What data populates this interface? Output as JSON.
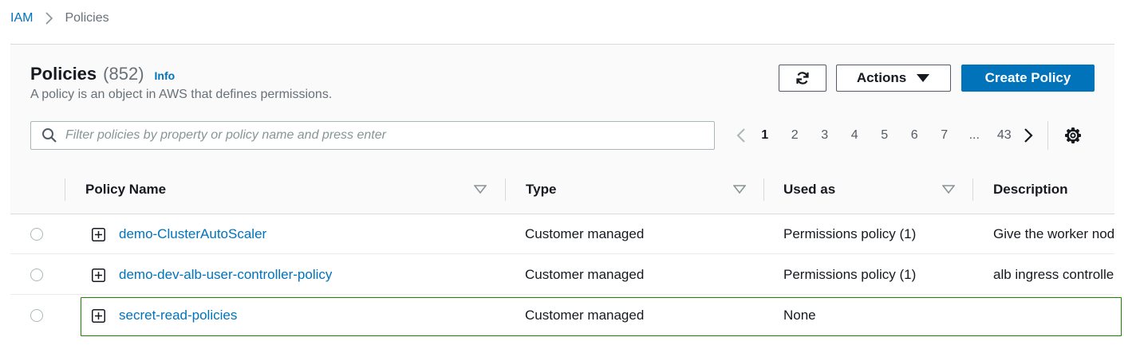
{
  "breadcrumb": {
    "root": "IAM",
    "current": "Policies"
  },
  "header": {
    "title": "Policies",
    "count": "(852)",
    "info": "Info",
    "description": "A policy is an object in AWS that defines permissions."
  },
  "toolbar": {
    "refresh_icon": "refresh-icon",
    "actions_label": "Actions",
    "create_label": "Create Policy"
  },
  "search": {
    "value": "",
    "placeholder": "Filter policies by property or policy name and press enter"
  },
  "pagination": {
    "pages": [
      "1",
      "2",
      "3",
      "4",
      "5",
      "6",
      "7"
    ],
    "current": "1",
    "ellipsis": "...",
    "last": "43"
  },
  "table": {
    "columns": [
      "Policy Name",
      "Type",
      "Used as",
      "Description"
    ],
    "rows": [
      {
        "name": "demo-ClusterAutoScaler",
        "type": "Customer managed",
        "used_as": "Permissions policy (1)",
        "description": "Give the worker nod"
      },
      {
        "name": "demo-dev-alb-user-controller-policy",
        "type": "Customer managed",
        "used_as": "Permissions policy (1)",
        "description": "alb ingress controlle"
      },
      {
        "name": "secret-read-policies",
        "type": "Customer managed",
        "used_as": "None",
        "description": ""
      }
    ]
  },
  "colors": {
    "link": "#0073bb",
    "primary_button": "#0073bb",
    "selected_outline": "#1d8102",
    "muted_text": "#687078"
  }
}
